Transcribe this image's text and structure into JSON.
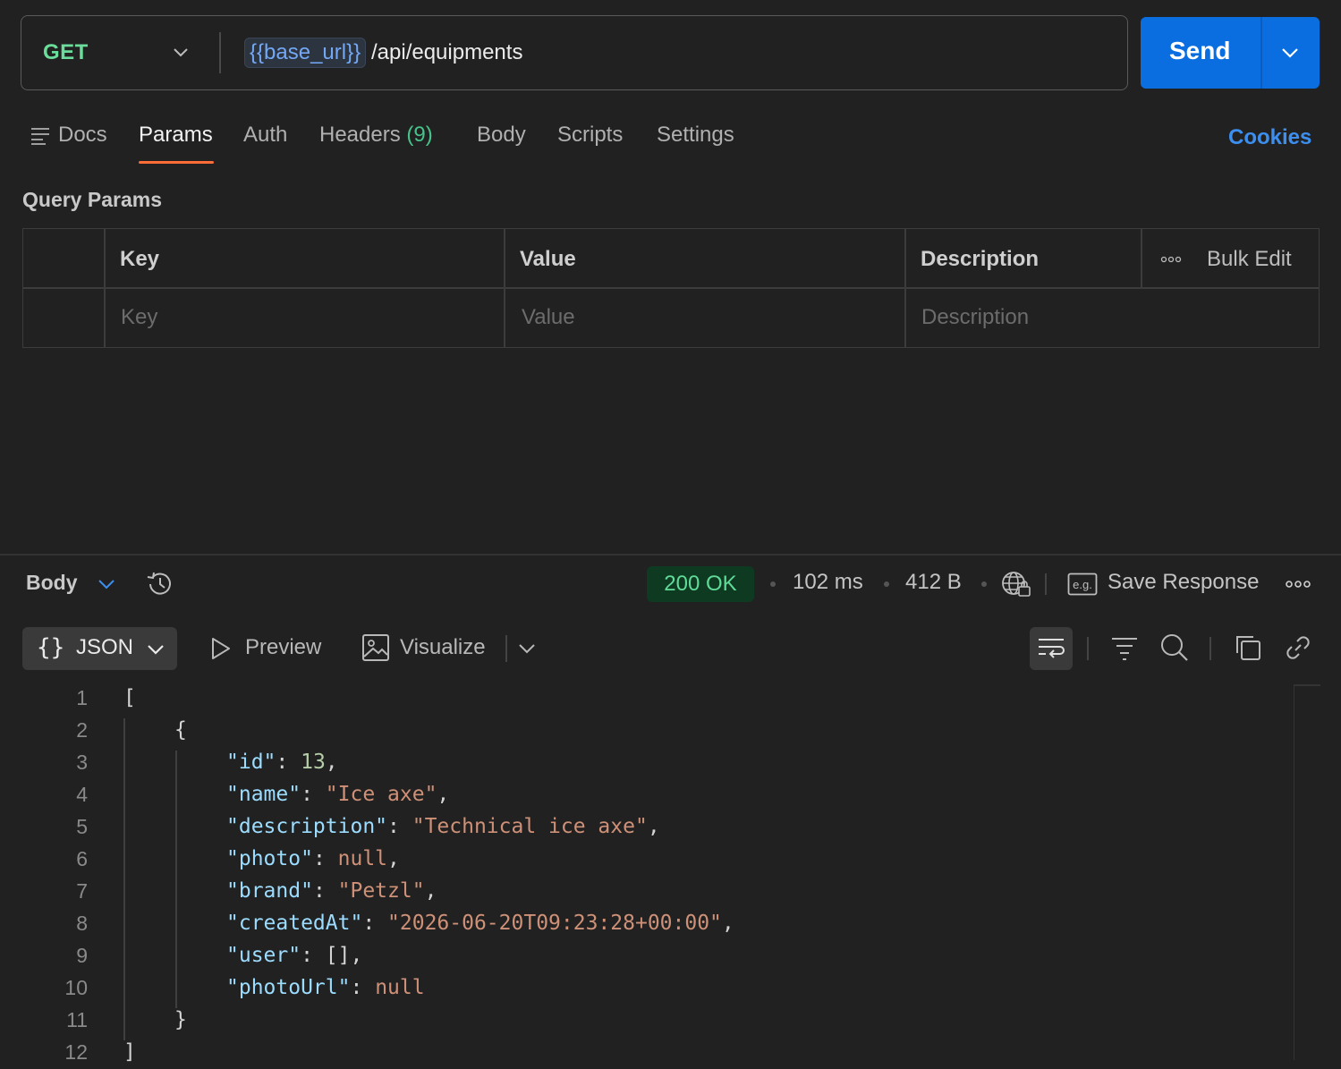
{
  "request": {
    "method": "GET",
    "url_variable": "{{base_url}}",
    "url_path": "/api/equipments",
    "send_label": "Send"
  },
  "tabs": [
    {
      "label": "Docs"
    },
    {
      "label": "Params",
      "active": true
    },
    {
      "label": "Auth"
    },
    {
      "label": "Headers",
      "count": "(9)"
    },
    {
      "label": "Body"
    },
    {
      "label": "Scripts"
    },
    {
      "label": "Settings"
    }
  ],
  "cookies_label": "Cookies",
  "query_params": {
    "title": "Query Params",
    "headers": {
      "key": "Key",
      "value": "Value",
      "description": "Description",
      "bulk_edit": "Bulk Edit"
    },
    "placeholders": {
      "key": "Key",
      "value": "Value",
      "description": "Description"
    }
  },
  "response": {
    "body_label": "Body",
    "status": "200 OK",
    "time": "102 ms",
    "size": "412 B",
    "save_response": "Save Response",
    "format": "JSON",
    "preview": "Preview",
    "visualize": "Visualize",
    "colors": {
      "status_bg": "#0f3a22",
      "status_text": "#5fdb97",
      "accent": "#0b6ee0"
    },
    "line_numbers": [
      "1",
      "2",
      "3",
      "4",
      "5",
      "6",
      "7",
      "8",
      "9",
      "10",
      "11",
      "12"
    ],
    "code": {
      "open_array": "[",
      "open_obj": "{",
      "fields": [
        {
          "key": "\"id\"",
          "value": "13",
          "type": "n",
          "comma": ","
        },
        {
          "key": "\"name\"",
          "value": "\"Ice axe\"",
          "type": "s",
          "comma": ","
        },
        {
          "key": "\"description\"",
          "value": "\"Technical ice axe\"",
          "type": "s",
          "comma": ","
        },
        {
          "key": "\"photo\"",
          "value": "null",
          "type": "nl",
          "comma": ","
        },
        {
          "key": "\"brand\"",
          "value": "\"Petzl\"",
          "type": "s",
          "comma": ","
        },
        {
          "key": "\"createdAt\"",
          "value": "\"2026-06-20T09:23:28+00:00\"",
          "type": "s",
          "comma": ","
        },
        {
          "key": "\"user\"",
          "value": "[]",
          "type": "p",
          "comma": ","
        },
        {
          "key": "\"photoUrl\"",
          "value": "null",
          "type": "nl",
          "comma": ""
        }
      ],
      "close_obj": "}",
      "close_array": "]"
    }
  }
}
